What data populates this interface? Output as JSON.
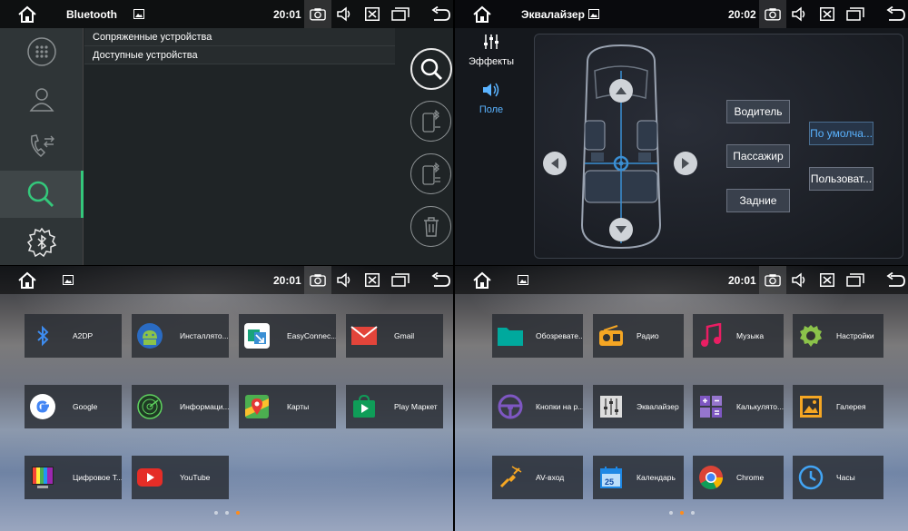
{
  "bluetooth_screen": {
    "status": {
      "title": "Bluetooth",
      "time": "20:01"
    },
    "list": [
      "Сопряженные устройства",
      "Доступные устройства"
    ],
    "sidebar": [
      "dialpad",
      "contacts",
      "call-log",
      "search",
      "bluetooth-settings"
    ],
    "right_buttons": [
      "search",
      "pair-phone",
      "unpair-phone",
      "delete"
    ]
  },
  "equalizer_screen": {
    "status": {
      "title": "Эквалайзер",
      "time": "20:02"
    },
    "tabs": {
      "effects": "Эффекты",
      "field": "Поле"
    },
    "seat_buttons": {
      "driver": "Водитель",
      "passenger": "Пассажир",
      "rear": "Задние"
    },
    "preset_buttons": {
      "default": "По умолча...",
      "user": "Пользоват..."
    }
  },
  "apps_page_1": {
    "status": {
      "time": "20:01"
    },
    "apps": [
      {
        "label": "A2DP",
        "icon": "bluetooth-icon"
      },
      {
        "label": "Инсталлято...",
        "icon": "android-installer-icon"
      },
      {
        "label": "EasyConnec...",
        "icon": "easyconnect-icon"
      },
      {
        "label": "Gmail",
        "icon": "gmail-icon"
      },
      {
        "label": "Google",
        "icon": "google-icon"
      },
      {
        "label": "Информаци...",
        "icon": "info-radar-icon"
      },
      {
        "label": "Карты",
        "icon": "maps-icon"
      },
      {
        "label": "Play Маркет",
        "icon": "play-store-icon"
      },
      {
        "label": "Цифровое Т...",
        "icon": "digital-tv-icon"
      },
      {
        "label": "YouTube",
        "icon": "youtube-icon"
      }
    ],
    "active_page": 3
  },
  "apps_page_2": {
    "status": {
      "time": "20:01"
    },
    "apps": [
      {
        "label": "Обозревате...",
        "icon": "folder-icon"
      },
      {
        "label": "Радио",
        "icon": "radio-icon"
      },
      {
        "label": "Музыка",
        "icon": "music-icon"
      },
      {
        "label": "Настройки",
        "icon": "settings-icon"
      },
      {
        "label": "Кнопки на р...",
        "icon": "steering-wheel-icon"
      },
      {
        "label": "Эквалайзер",
        "icon": "equalizer-icon"
      },
      {
        "label": "Калькулято...",
        "icon": "calculator-icon"
      },
      {
        "label": "Галерея",
        "icon": "gallery-icon"
      },
      {
        "label": "AV-вход",
        "icon": "av-input-icon"
      },
      {
        "label": "Календарь",
        "icon": "calendar-icon"
      },
      {
        "label": "Chrome",
        "icon": "chrome-icon"
      },
      {
        "label": "Часы",
        "icon": "clock-icon"
      }
    ],
    "calendar_day": "25",
    "active_page": 2
  },
  "colors": {
    "accent_green": "#34c77b",
    "accent_blue": "#5ab3ff",
    "page_dot": "#ff8c1a"
  }
}
